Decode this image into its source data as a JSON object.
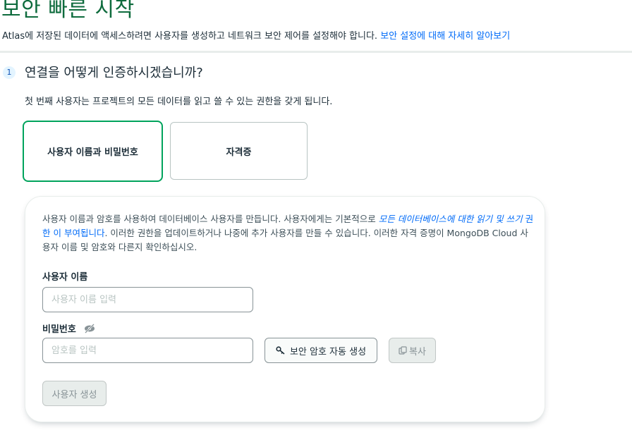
{
  "page": {
    "title": "보안 빠른 시작",
    "intro_text": "Atlas에 저장된 데이터에 액세스하려면 사용자를 생성하고 네트워크 보안 제어를 설정해야 합니다. ",
    "intro_link": "보안 설정에 대해 자세히 알아보기"
  },
  "step": {
    "number": "1",
    "title": "연결을 어떻게 인증하시겠습니까?",
    "description": "첫 번째 사용자는 프로젝트의 모든 데이터를 읽고 쓸 수 있는 권한을 갖게 됩니다."
  },
  "auth_options": [
    {
      "label": "사용자 이름과 비밀번호",
      "selected": true
    },
    {
      "label": "자격증",
      "selected": false
    }
  ],
  "form": {
    "desc_part1": "사용자 이름과 암호를 사용하여 데이터베이스 사용자를 만듭니다. 사용자에게는 기본적으로 ",
    "desc_italic": "모든 데이터베이스에 대한 읽기 및 쓰기",
    "desc_link": " 권한 이 부여됩니다",
    "desc_part2": ". 이러한 권한을 업데이트하거나 나중에 추가 사용자를 만들 수 있습니다. 이러한 자격 증명이 MongoDB Cloud 사용자 이름 및 암호와 다른지 확인하십시오.",
    "username_label": "사용자 이름",
    "username_placeholder": "사용자 이름 입력",
    "username_value": "",
    "password_label": "비밀번호",
    "password_placeholder": "암호를 입력",
    "password_value": "",
    "autogen_label": "보안 암호 자동 생성",
    "copy_label": "복사",
    "create_label": "사용자 생성"
  },
  "colors": {
    "brand_green": "#0e6b3d",
    "selected_border": "#00a35c",
    "link_blue": "#016bf8"
  },
  "icons": [
    "eye-slash-icon",
    "key-icon",
    "copy-icon"
  ]
}
